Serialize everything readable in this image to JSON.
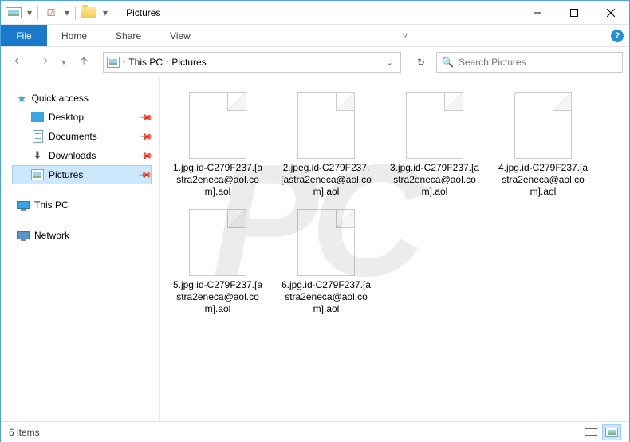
{
  "title": "Pictures",
  "ribbon": {
    "file": "File",
    "tabs": [
      "Home",
      "Share",
      "View"
    ]
  },
  "breadcrumb": [
    "This PC",
    "Pictures"
  ],
  "search_placeholder": "Search Pictures",
  "sidebar": {
    "quick": "Quick access",
    "items": [
      {
        "label": "Desktop",
        "pinned": true
      },
      {
        "label": "Documents",
        "pinned": true
      },
      {
        "label": "Downloads",
        "pinned": true
      },
      {
        "label": "Pictures",
        "pinned": true,
        "selected": true
      }
    ],
    "thispc": "This PC",
    "network": "Network"
  },
  "files": [
    {
      "name": "1.jpg.id-C279F237.[astra2eneca@aol.com].aol"
    },
    {
      "name": "2.jpeg.id-C279F237.[astra2eneca@aol.com].aol"
    },
    {
      "name": "3.jpg.id-C279F237.[astra2eneca@aol.com].aol"
    },
    {
      "name": "4.jpg.id-C279F237.[astra2eneca@aol.com].aol"
    },
    {
      "name": "5.jpg.id-C279F237.[astra2eneca@aol.com].aol"
    },
    {
      "name": "6.jpg.id-C279F237.[astra2eneca@aol.com].aol"
    }
  ],
  "status": "6 items"
}
